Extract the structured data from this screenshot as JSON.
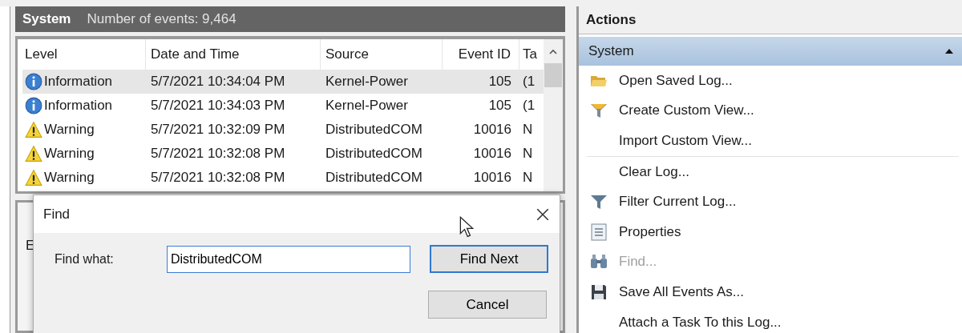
{
  "log_header": {
    "title": "System",
    "count": "Number of events: 9,464"
  },
  "table": {
    "columns": [
      "Level",
      "Date and Time",
      "Source",
      "Event ID",
      "Ta"
    ],
    "rows": [
      {
        "kind": "info",
        "level": "Information",
        "date": "5/7/2021 10:34:04 PM",
        "source": "Kernel-Power",
        "event_id": "105",
        "column_5": "(1",
        "selected": true
      },
      {
        "kind": "info",
        "level": "Information",
        "date": "5/7/2021 10:34:03 PM",
        "source": "Kernel-Power",
        "event_id": "105",
        "column_5": "(1",
        "selected": false
      },
      {
        "kind": "warning",
        "level": "Warning",
        "date": "5/7/2021 10:32:09 PM",
        "source": "DistributedCOM",
        "event_id": "10016",
        "column_5": "N",
        "selected": false
      },
      {
        "kind": "warning",
        "level": "Warning",
        "date": "5/7/2021 10:32:08 PM",
        "source": "DistributedCOM",
        "event_id": "10016",
        "column_5": "N",
        "selected": false
      },
      {
        "kind": "warning",
        "level": "Warning",
        "date": "5/7/2021 10:32:08 PM",
        "source": "DistributedCOM",
        "event_id": "10016",
        "column_5": "N",
        "selected": false
      }
    ]
  },
  "lower_tab": "E",
  "find_dialog": {
    "title": "Find",
    "label": "Find what:",
    "value": "DistributedCOM",
    "buttons": [
      {
        "label": "Find Next",
        "default": true
      },
      {
        "label": "Cancel",
        "default": false
      }
    ]
  },
  "actions": {
    "title": "Actions",
    "section": {
      "label": "System",
      "expanded": true
    },
    "items": [
      {
        "kind": "folder",
        "label": "Open Saved Log...",
        "disabled": false
      },
      {
        "kind": "newfilter",
        "label": "Create Custom View...",
        "disabled": false
      },
      {
        "kind": "plain",
        "label": "Import Custom View...",
        "disabled": false
      },
      {
        "kind": "separator"
      },
      {
        "kind": "plain",
        "label": "Clear Log...",
        "disabled": false
      },
      {
        "kind": "filter",
        "label": "Filter Current Log...",
        "disabled": false
      },
      {
        "kind": "properties",
        "label": "Properties",
        "disabled": false
      },
      {
        "kind": "binoculars",
        "label": "Find...",
        "disabled": true
      },
      {
        "kind": "disk",
        "label": "Save All Events As...",
        "disabled": false
      },
      {
        "kind": "plain",
        "label": "Attach a Task To this Log...",
        "disabled": false
      }
    ]
  }
}
